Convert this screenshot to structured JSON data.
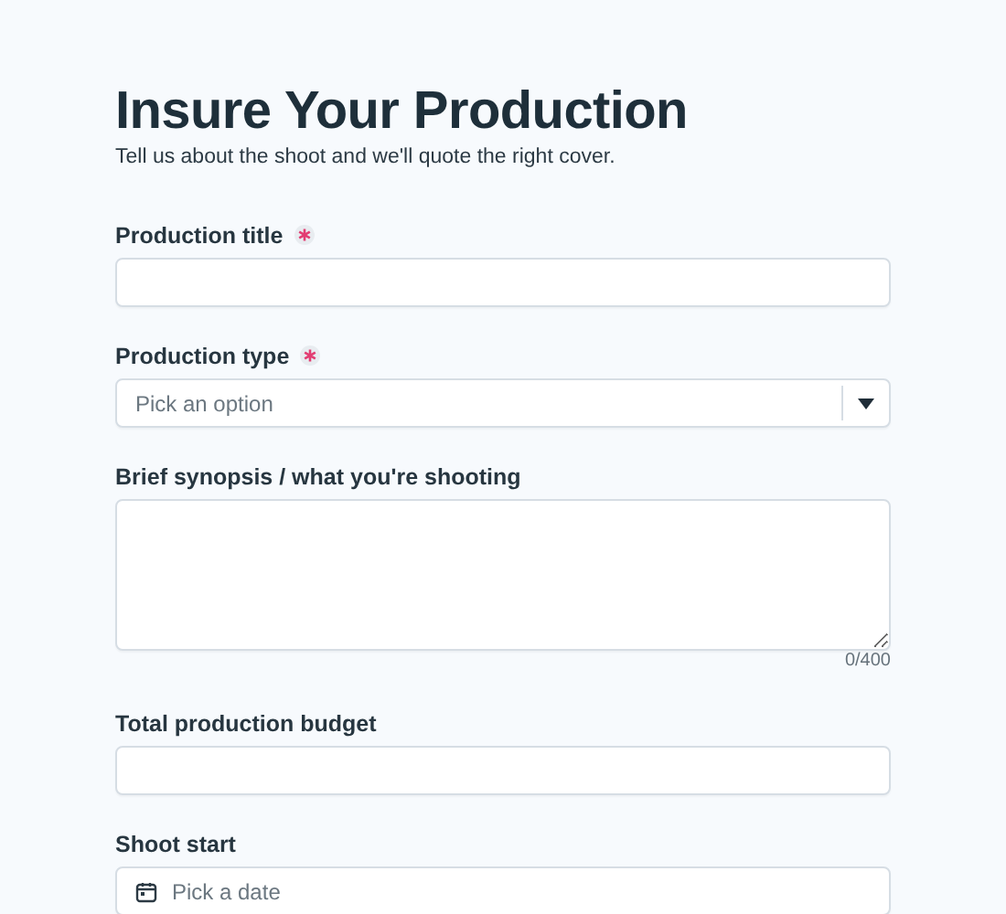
{
  "title": "Insure Your Production",
  "subtitle": "Tell us about the shoot and we'll quote the right cover.",
  "fields": [
    {
      "kind": "text",
      "label": "Production title",
      "required": true
    },
    {
      "kind": "select",
      "label": "Production type",
      "required": true,
      "placeholder": "Pick an option"
    },
    {
      "kind": "textarea",
      "label": "Brief synopsis / what you're shooting",
      "required": false,
      "counter": "0/400"
    },
    {
      "kind": "text",
      "label": "Total production budget",
      "required": false
    },
    {
      "kind": "date",
      "label": "Shoot start",
      "required": false,
      "placeholder": "Pick a date"
    }
  ]
}
